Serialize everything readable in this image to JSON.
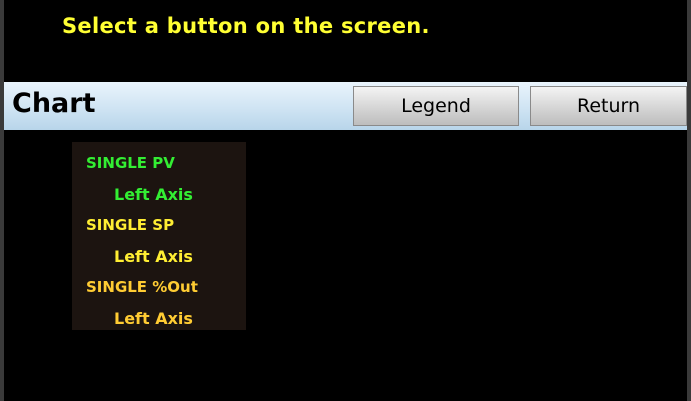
{
  "prompt": {
    "text": "Select a button on the screen."
  },
  "header": {
    "title": "Chart",
    "buttons": {
      "legend_label": "Legend",
      "return_label": "Return"
    }
  },
  "legend": {
    "entries": [
      {
        "name": "SINGLE PV",
        "axis": "Left Axis",
        "color": "#33ee33"
      },
      {
        "name": "SINGLE SP",
        "axis": "Left Axis",
        "color": "#ffee33"
      },
      {
        "name": "SINGLE %Out",
        "axis": "Left Axis",
        "color": "#ffcc33"
      }
    ]
  },
  "colors": {
    "prompt_text": "#ffff33",
    "background": "#000000",
    "header_bar": "#cfe4f3"
  }
}
